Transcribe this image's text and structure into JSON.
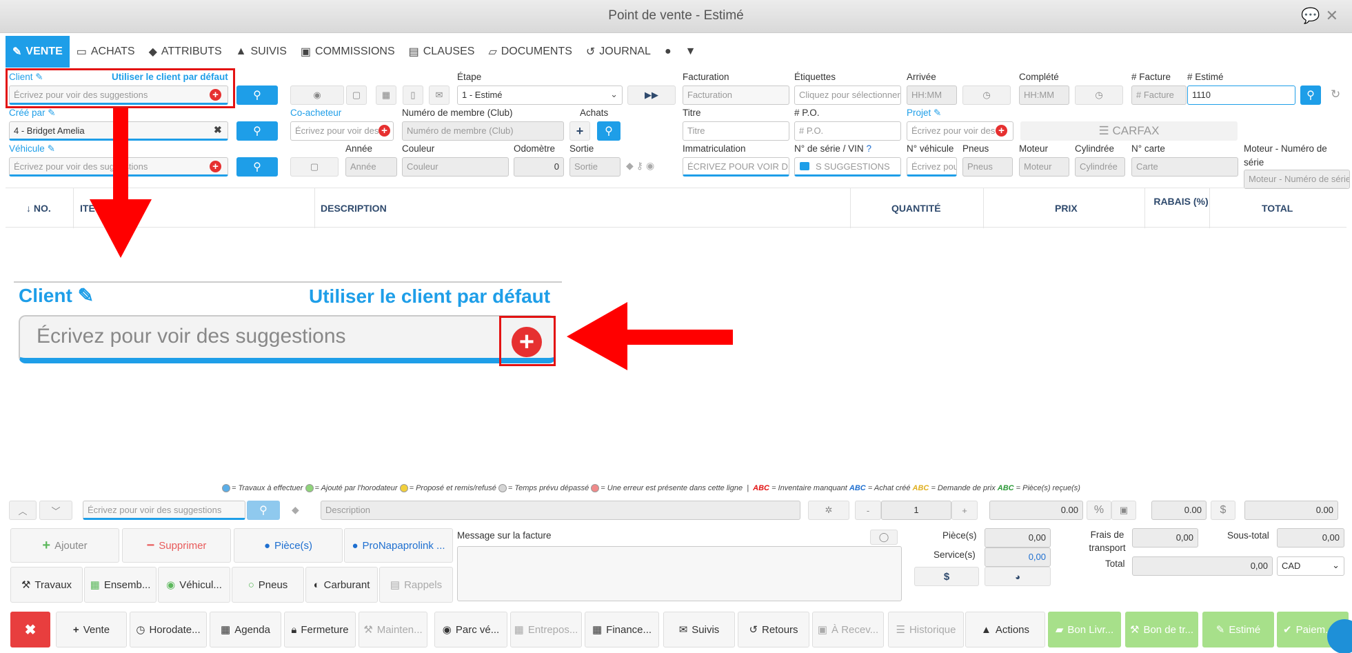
{
  "window": {
    "title": "Point de vente - Estimé"
  },
  "tabs": [
    {
      "label": "VENTE",
      "icon": "edit-icon"
    },
    {
      "label": "ACHATS",
      "icon": "card-icon"
    },
    {
      "label": "ATTRIBUTS",
      "icon": "tags-icon"
    },
    {
      "label": "SUIVIS",
      "icon": "bell-icon"
    },
    {
      "label": "COMMISSIONS",
      "icon": "money-icon"
    },
    {
      "label": "CLAUSES",
      "icon": "file-icon"
    },
    {
      "label": "DOCUMENTS",
      "icon": "folder-icon"
    },
    {
      "label": "JOURNAL",
      "icon": "history-icon"
    }
  ],
  "form": {
    "client_label": "Client",
    "default_client_link": "Utiliser le client par défaut",
    "client_placeholder": "Écrivez pour voir des suggestions",
    "etape_label": "Étape",
    "etape_value": "1 - Estimé",
    "facturation_label": "Facturation",
    "facturation_placeholder": "Facturation",
    "etiquettes_label": "Étiquettes",
    "etiquettes_placeholder": "Cliquez pour sélectionner",
    "arrivee_label": "Arrivée",
    "arrivee_placeholder": "HH:MM",
    "complete_label": "Complété",
    "complete_placeholder": "HH:MM",
    "facture_label": "# Facture",
    "facture_placeholder": "# Facture",
    "estime_label": "# Estimé",
    "estime_value": "1110",
    "cree_par_label": "Créé par",
    "cree_par_value": "4 - Bridget Amelia",
    "coacheteur_label": "Co-acheteur",
    "coacheteur_placeholder": "Écrivez pour voir des",
    "membre_label": "Numéro de membre (Club)",
    "membre_placeholder": "Numéro de membre (Club)",
    "achats_label": "Achats",
    "titre_label": "Titre",
    "titre_placeholder": "Titre",
    "po_label": "# P.O.",
    "po_placeholder": "# P.O.",
    "projet_label": "Projet",
    "projet_placeholder": "Écrivez pour voir des",
    "carfax_label": "CARFAX",
    "vehicule_label": "Véhicule",
    "vehicule_placeholder": "Écrivez pour voir des suggestions",
    "annee_label": "Année",
    "annee_placeholder": "Année",
    "couleur_label": "Couleur",
    "couleur_placeholder": "Couleur",
    "odometre_label": "Odomètre",
    "odometre_value": "0",
    "sortie_label": "Sortie",
    "sortie_placeholder": "Sortie",
    "immat_label": "Immatriculation",
    "immat_placeholder": "ÉCRIVEZ POUR VOIR DES",
    "vin_label": "N° de série / VIN",
    "vin_placeholder": "ÉCRIVEZ POUR VOIR DES SUGGESTIONS",
    "vin_visible": "S SUGGESTIONS",
    "novehicule_label": "N° véhicule",
    "novehicule_placeholder": "Écrivez pou",
    "pneus_label": "Pneus",
    "pneus_placeholder": "Pneus",
    "moteur_label": "Moteur",
    "moteur_placeholder": "Moteur",
    "cylindree_label": "Cylindrée",
    "cylindree_placeholder": "Cylindrée",
    "carte_label": "N° carte",
    "carte_placeholder": "Carte",
    "moteur_serie_label": "Moteur - Numéro de série",
    "moteur_serie_placeholder": "Moteur - Numéro de série"
  },
  "table": {
    "headers": [
      "↓ NO.",
      "ITE",
      "DESCRIPTION",
      "QUANTITÉ",
      "PRIX",
      "RABAIS (%)",
      "TOTAL"
    ]
  },
  "zoom": {
    "client_label": "Client",
    "default_link": "Utiliser le client par défaut",
    "placeholder": "Écrivez pour voir des suggestions"
  },
  "legend": {
    "items": [
      {
        "color": "#5aaee8",
        "text": "= Travaux à effectuer"
      },
      {
        "color": "#8fd47a",
        "text": "= Ajouté par l'horodateur"
      },
      {
        "color": "#f2d03b",
        "text": "= Proposé et remis/refusé"
      },
      {
        "color": "#d5d5d5",
        "text": "= Temps prévu dépassé"
      },
      {
        "color": "#f08a8a",
        "text": "= Une erreur est présente dans cette ligne"
      }
    ],
    "sep": "|",
    "abc": "ABC",
    "abc_items": [
      {
        "color": "#e31212",
        "text": "= Inventaire manquant"
      },
      {
        "color": "#1e6fd0",
        "text": "= Achat créé"
      },
      {
        "color": "#e0b020",
        "text": "= Demande de prix"
      },
      {
        "color": "#2e9a3a",
        "text": "= Pièce(s) reçue(s)"
      }
    ]
  },
  "entry": {
    "search_placeholder": "Écrivez pour voir des suggestions",
    "description_placeholder": "Description",
    "minus": "-",
    "qty": "1",
    "plus": "+",
    "price": "0.00",
    "pct": "%",
    "discount": "0.00",
    "dollar": "$",
    "total": "0.00"
  },
  "actions": {
    "ajouter": "Ajouter",
    "supprimer": "Supprimer",
    "pieces": "Pièce(s)",
    "pronapa": "ProNapaprolink ...",
    "travaux": "Travaux",
    "ensemb": "Ensemb...",
    "vehicul": "Véhicul...",
    "pneus": "Pneus",
    "carburant": "Carburant",
    "rappels": "Rappels"
  },
  "message": {
    "label": "Message sur la facture"
  },
  "totals": {
    "pieces_label": "Pièce(s)",
    "pieces_value": "0,00",
    "service_label": "Service(s)",
    "service_value": "0,00",
    "frais_label": "Frais de transport",
    "frais_value": "0,00",
    "sous_total_label": "Sous-total",
    "sous_total_value": "0,00",
    "total_label": "Total",
    "total_value": "0,00",
    "currency": "CAD",
    "dollar": "$"
  },
  "bottom": [
    {
      "label": "",
      "icon": "close-icon",
      "style": "red"
    },
    {
      "label": "Vente",
      "icon": "plus-icon",
      "style": ""
    },
    {
      "label": "Horodate...",
      "icon": "clock-icon",
      "style": ""
    },
    {
      "label": "Agenda",
      "icon": "calendar-icon",
      "style": ""
    },
    {
      "label": "Fermeture",
      "icon": "lock-icon",
      "style": ""
    },
    {
      "label": "Mainten...",
      "icon": "wrench-icon",
      "style": "dis"
    },
    {
      "label": "Parc vé...",
      "icon": "car-icon",
      "style": ""
    },
    {
      "label": "Entrepos...",
      "icon": "warehouse-icon",
      "style": "dis"
    },
    {
      "label": "Finance...",
      "icon": "calculator-icon",
      "style": ""
    },
    {
      "label": "Suivis",
      "icon": "mail-icon",
      "style": ""
    },
    {
      "label": "Retours",
      "icon": "undo-icon",
      "style": ""
    },
    {
      "label": "À Recev...",
      "icon": "money-icon",
      "style": "dis"
    },
    {
      "label": "Historique",
      "icon": "list-icon",
      "style": "dis"
    },
    {
      "label": "Actions",
      "icon": "caret-up-icon",
      "style": ""
    },
    {
      "label": "Bon Livr...",
      "icon": "truck-icon",
      "style": "green"
    },
    {
      "label": "Bon de tr...",
      "icon": "wrench-icon",
      "style": "green"
    },
    {
      "label": "Estimé",
      "icon": "edit-icon",
      "style": "green"
    },
    {
      "label": "Paiem...",
      "icon": "check-icon",
      "style": "green"
    }
  ]
}
